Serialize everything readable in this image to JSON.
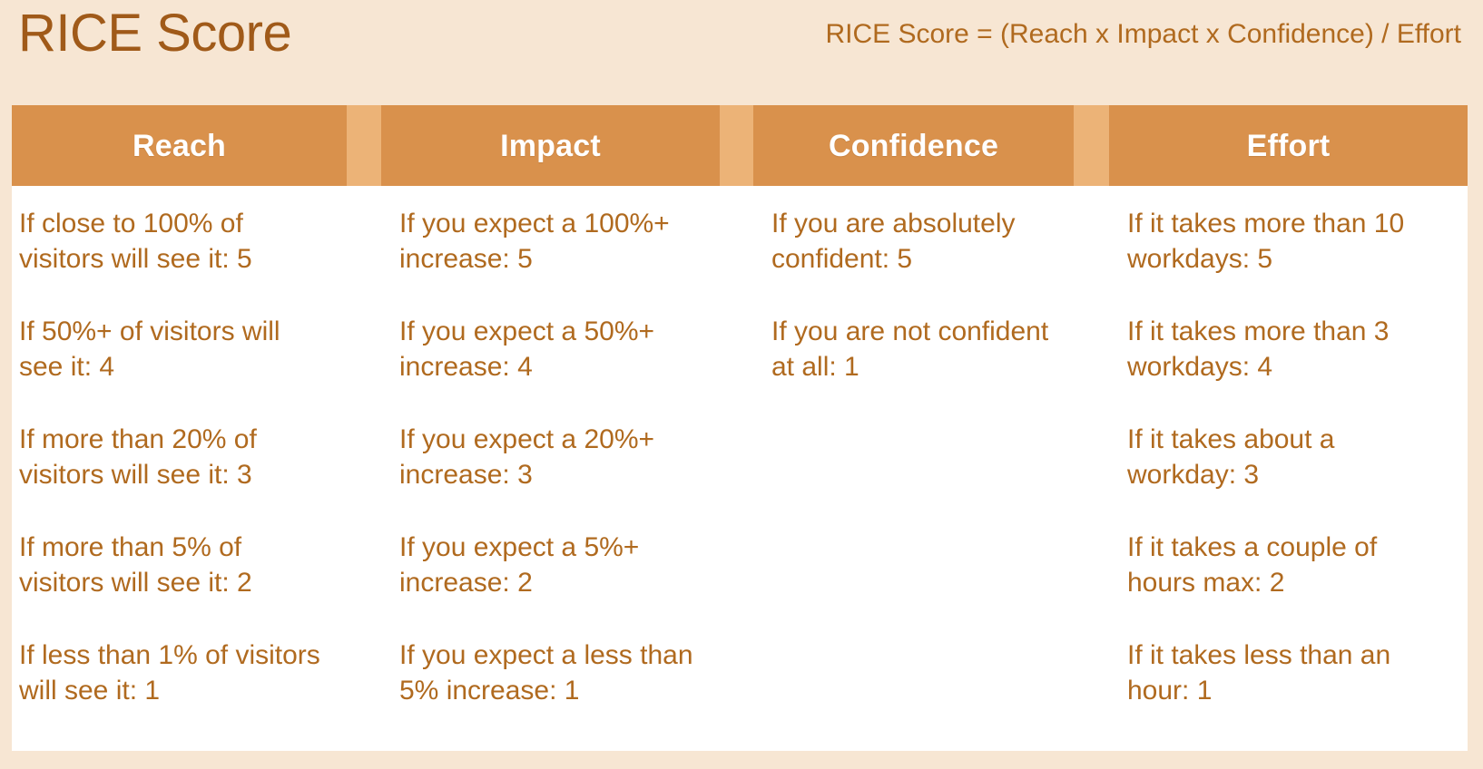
{
  "header": {
    "title": "RICE Score",
    "formula": "RICE Score = (Reach x Impact x Confidence) / Effort"
  },
  "colors": {
    "page_background": "#f7e6d3",
    "header_cell": "#d9914c",
    "header_gap": "#ecb377",
    "header_text": "#ffffff",
    "body_background": "#ffffff",
    "body_text": "#b06a1f",
    "title_text": "#a05a19"
  },
  "table": {
    "columns": [
      {
        "label": "Reach",
        "entries": [
          "If close to 100% of visitors will see it: 5",
          "If 50%+ of visitors will see it: 4",
          "If more than 20% of visitors will see it: 3",
          "If more than 5% of visitors will see it: 2",
          "If less than 1% of visitors will see it: 1"
        ]
      },
      {
        "label": "Impact",
        "entries": [
          "If you expect a 100%+ increase: 5",
          "If you expect a 50%+ increase: 4",
          "If you expect a 20%+ increase: 3",
          "If you expect a 5%+ increase: 2",
          "If you expect a less than 5% increase: 1"
        ]
      },
      {
        "label": "Confidence",
        "entries": [
          "If you are absolutely confident: 5",
          "If you are not confident at all: 1"
        ]
      },
      {
        "label": "Effort",
        "entries": [
          "If it takes more than 10 workdays: 5",
          "If it takes more than 3 workdays: 4",
          "If it takes about a workday: 3",
          "If it takes a couple of hours max: 2",
          "If it takes less than an hour: 1"
        ]
      }
    ]
  }
}
